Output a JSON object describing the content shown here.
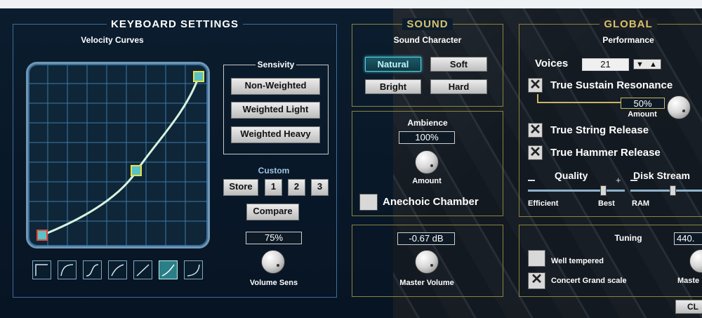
{
  "keyboard": {
    "title": "KEYBOARD SETTINGS",
    "velocity_title": "Velocity Curves",
    "sensitivity_title": "Sensivity",
    "sensitivity_buttons": [
      "Non-Weighted",
      "Weighted Light",
      "Weighted Heavy"
    ],
    "custom_title": "Custom",
    "store_label": "Store",
    "preset_labels": [
      "1",
      "2",
      "3"
    ],
    "compare_label": "Compare",
    "volume_sens_value": "75%",
    "volume_sens_label": "Volume Sens"
  },
  "sound": {
    "title": "SOUND",
    "character_title": "Sound Character",
    "character_buttons": [
      "Natural",
      "Soft",
      "Bright",
      "Hard"
    ],
    "selected_character": "Natural",
    "ambience_title": "Ambience",
    "ambience_value": "100%",
    "ambience_knob_label": "Amount",
    "anechoic_label": "Anechoic Chamber",
    "master_volume_value": "-0.67 dB",
    "master_volume_label": "Master Volume"
  },
  "global": {
    "title": "GLOBAL",
    "performance_title": "Performance",
    "voices_label": "Voices",
    "voices_value": "21",
    "sustain_label": "True Sustain Resonance",
    "sustain_amount_value": "50%",
    "sustain_amount_label": "Amount",
    "string_release_label": "True String Release",
    "hammer_release_label": "True Hammer Release",
    "quality_label": "Quality",
    "quality_min": "Efficient",
    "quality_max": "Best",
    "quality_level": 0.8,
    "disk_label": "Disk Stream",
    "disk_min": "RAM",
    "tuning_title": "Tuning",
    "tuning_value": "440.",
    "well_tempered_label": "Well tempered",
    "concert_grand_label": "Concert Grand scale",
    "master_tune_label": "Maste",
    "bottom_button_label": "CL"
  },
  "colors": {
    "accent_cyan": "#3fd3e8",
    "gold_border": "#8a8440",
    "curve_point": "#e8e04a"
  }
}
